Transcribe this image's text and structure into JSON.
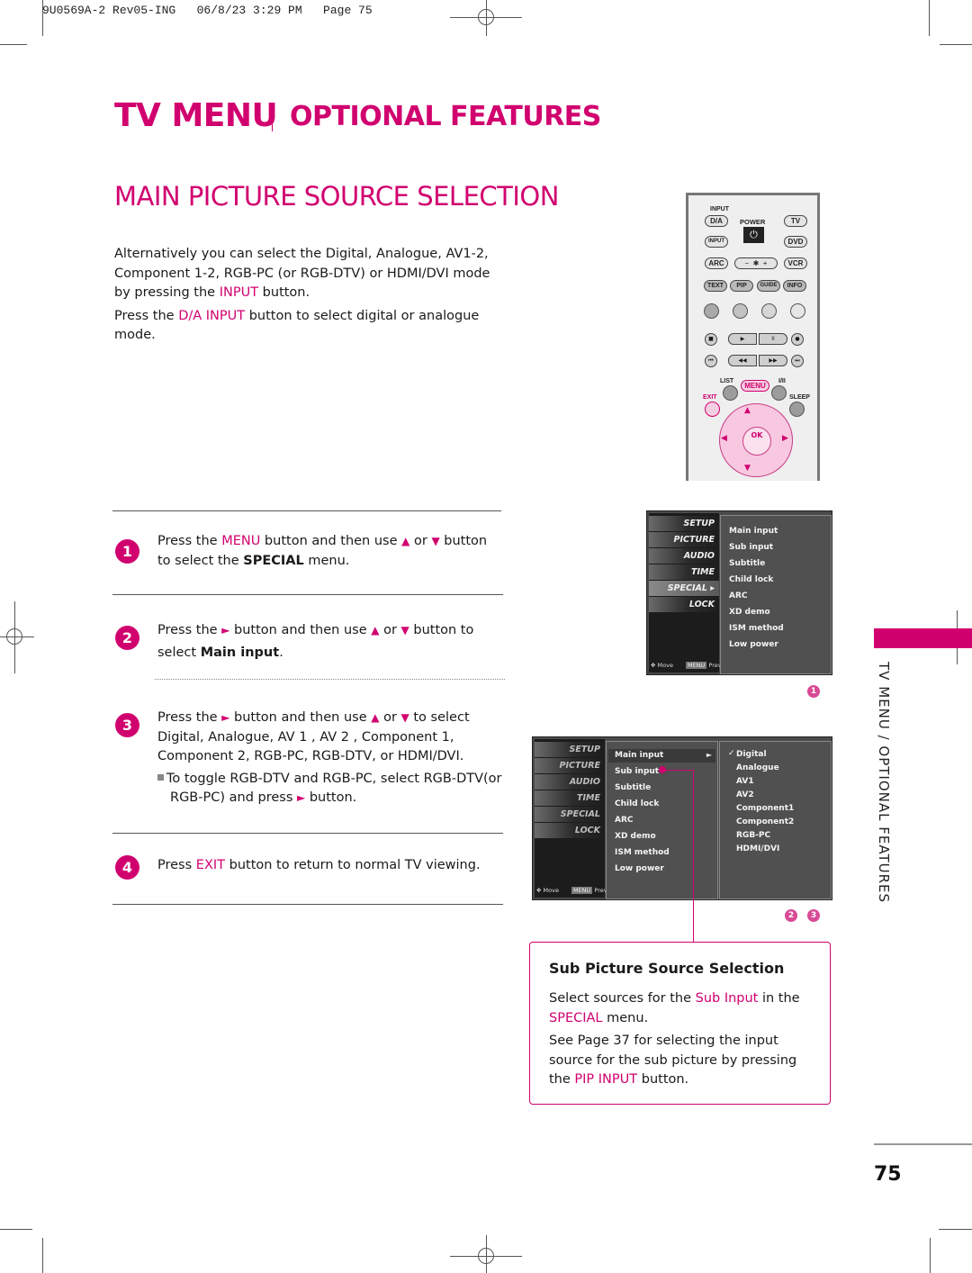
{
  "print_slug": "9U0569A-2 Rev05-ING   06/8/23 3:29 PM   Page 75",
  "header": {
    "title": "TV MENU",
    "subtitle": "OPTIONAL FEATURES"
  },
  "section_title": "MAIN PICTURE SOURCE SELECTION",
  "intro": {
    "p1_a": "Alternatively you can select the Digital, Analogue, AV1-2, Component 1-2, RGB-PC (or RGB-DTV) or HDMI/DVI mode by pressing the ",
    "p1_hl": "INPUT",
    "p1_b": " button.",
    "p2_a": "Press the ",
    "p2_hl": "D/A INPUT",
    "p2_b": " button to select digital or analogue mode."
  },
  "steps": [
    {
      "number": "1",
      "a": "Press the ",
      "hl": "MENU",
      "b": " button and then use ",
      "up": "▲",
      "or": " or ",
      "down": "▼",
      "c": " button to select the ",
      "bold": "SPECIAL",
      "d": " menu."
    },
    {
      "number": "2",
      "a": "Press the ",
      "right": "►",
      "b": " button and then use ",
      "up": "▲",
      "or": " or ",
      "down": "▼",
      "c": " button to select ",
      "bold": "Main input",
      "d": "."
    },
    {
      "number": "3",
      "a": "Press the ",
      "right": "►",
      "b": " button and then use ",
      "up": "▲",
      "or": " or ",
      "down": "▼",
      "c": " to select Digital, Analogue, AV 1 , AV 2 , Component 1, Component 2, RGB-PC, RGB-DTV, or HDMI/DVI.",
      "note_a": "To toggle RGB-DTV and RGB-PC, select RGB-DTV(or RGB-PC) and press ",
      "note_right": "►",
      "note_b": " button."
    },
    {
      "number": "4",
      "a": "Press ",
      "hl": "EXIT",
      "b": " button to return to normal TV viewing."
    }
  ],
  "remote": {
    "input_label": "INPUT",
    "da": "D/A",
    "power": "POWER",
    "power_icon": "⏻",
    "tv": "TV",
    "input": "INPUT",
    "dvd": "DVD",
    "arc": "ARC",
    "minus": "−",
    "brightness": "✱",
    "plus": "+",
    "vcr": "VCR",
    "text": "TEXT",
    "pip": "PIP",
    "guide": "GUIDE",
    "info": "INFO",
    "stop": "■",
    "play": "▶",
    "pause": "II",
    "rec": "●",
    "prev": "⏮",
    "rew": "◀◀",
    "ff": "▶▶",
    "next": "⏭",
    "list": "LIST",
    "menu": "MENU",
    "i_ii": "I/II",
    "exit": "EXIT",
    "sleep": "SLEEP",
    "ok": "OK",
    "up": "▲",
    "down": "▼",
    "left": "◀",
    "right": "▶"
  },
  "osd1": {
    "side": [
      "SETUP",
      "PICTURE",
      "AUDIO",
      "TIME",
      "SPECIAL ▸",
      "LOCK"
    ],
    "items": [
      "Main input",
      "Sub input",
      "Subtitle",
      "Child lock",
      "ARC",
      "XD demo",
      "ISM method",
      "Low power"
    ],
    "foot_move": "Move",
    "foot_menu": "MENU",
    "foot_prev": "Prev",
    "badge": "1"
  },
  "osd2": {
    "side": [
      "SETUP",
      "PICTURE",
      "AUDIO",
      "TIME",
      "SPECIAL",
      "LOCK"
    ],
    "items": [
      "Main input",
      "Sub input",
      "Subtitle",
      "Child lock",
      "ARC",
      "XD demo",
      "ISM method",
      "Low power"
    ],
    "arrow": "►",
    "options": [
      "Digital",
      "Analogue",
      "AV1",
      "AV2",
      "Component1",
      "Component2",
      "RGB-PC",
      "HDMI/DVI"
    ],
    "check": "✓",
    "foot_move": "Move",
    "foot_menu": "MENU",
    "foot_prev": "Prev",
    "badges": [
      "2",
      "3"
    ]
  },
  "sub_picture": {
    "title": "Sub Picture Source Selection",
    "p1_a": "Select sources for the ",
    "p1_hl": "Sub Input",
    "p1_b": " in the ",
    "p1_hl2": "SPECIAL",
    "p1_c": " menu.",
    "p2_a": "See Page 37 for selecting the input source for the sub picture by pressing the ",
    "p2_hl": "PIP INPUT",
    "p2_b": " button."
  },
  "side_tab_label": "TV MENU / OPTIONAL FEATURES",
  "page_number": "75",
  "colors": {
    "accent": "#d1006f",
    "osd_bg": "#4a4a4a"
  }
}
